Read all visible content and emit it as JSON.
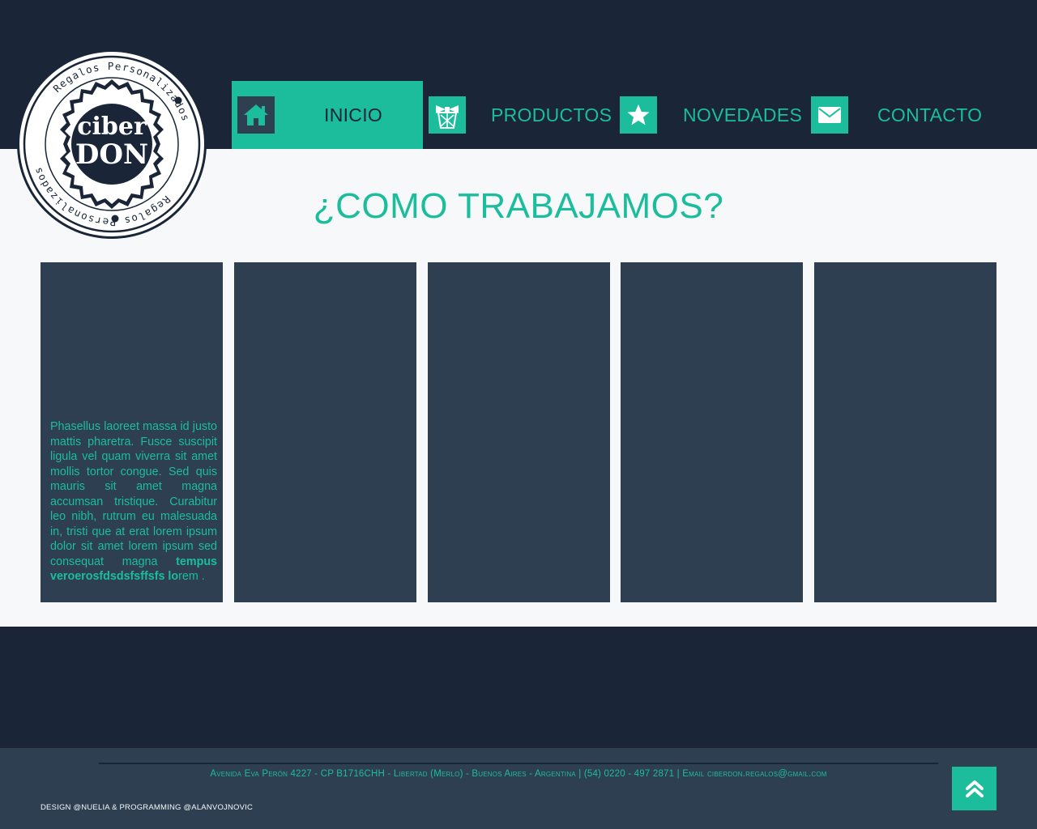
{
  "logo": {
    "line1": "ciber",
    "line2": "DON",
    "ring_text": "Regalos Personalizados",
    "colors": {
      "dark": "#1a2638",
      "light": "#ffffff"
    }
  },
  "nav": {
    "items": [
      {
        "label": "INICIO",
        "icon": "home-icon",
        "active": true
      },
      {
        "label": "PRODUCTOS",
        "icon": "gift-icon",
        "active": false
      },
      {
        "label": "NOVEDADES",
        "icon": "star-icon",
        "active": false
      },
      {
        "label": "CONTACTO",
        "icon": "envelope-icon",
        "active": false
      }
    ]
  },
  "main": {
    "title": "¿COMO TRABAJAMOS?",
    "cards": [
      {
        "text_start": "Phasellus laoreet massa id justo mattis pharetra. Fusce suscipit ligula vel quam viverra sit amet mollis tortor congue. Sed quis mauris sit amet magna accumsan tristique. Curabitur leo nibh, rutrum eu malesuada in, tristi que at erat lorem ipsum dolor  sit amet lorem ipsum sed consequat magna ",
        "text_bold": "tempus veroerosfdsdsfsffsfs lo",
        "text_end": "rem ."
      },
      {
        "text": ""
      },
      {
        "text": ""
      },
      {
        "text": ""
      },
      {
        "text": ""
      }
    ]
  },
  "footer": {
    "address": "Avenida Eva Perón 4227 - CP B1716CHH - Libertad (Merlo) - Buenos Aires - Argentina | (54) 0220 - 497 2871 | Email ciberdon.regalos@gmail.com",
    "credits": "Design @Nuelia & Programming @alanvojnovic",
    "scroll_top_icon": "double-chevron-up-icon"
  },
  "colors": {
    "navy": "#1a2638",
    "slate": "#2e3f52",
    "teal": "#1bbd9c",
    "off_white": "#f6f8fa"
  }
}
